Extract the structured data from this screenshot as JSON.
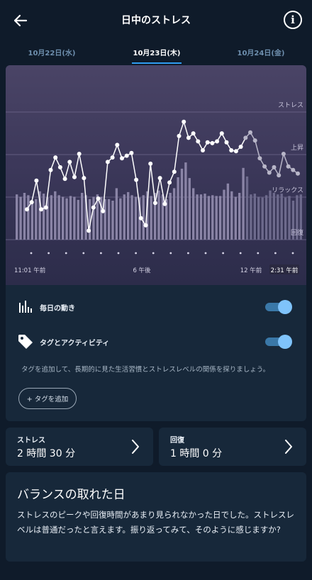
{
  "header": {
    "title": "日中のストレス",
    "back_icon": "arrow-left-icon",
    "info_icon": "info-circle-icon",
    "info_glyph": "i"
  },
  "date_tabs": [
    {
      "label": "10月22日(水)",
      "active": false
    },
    {
      "label": "10月23日(木)",
      "active": true
    },
    {
      "label": "10月24日(金)",
      "active": false
    }
  ],
  "chart": {
    "level_labels": [
      "ストレス",
      "上昇",
      "リラックス",
      "回復"
    ],
    "time_labels": {
      "start": "11:01 午前",
      "mid1": "6 午後",
      "mid2": "12 午前",
      "end": "2:31 午前"
    },
    "colors": {
      "line": "#ffffff",
      "bar": "#8a84a6",
      "bar_faded": "#6d6a8c",
      "line_faded": "#b8b6c8"
    }
  },
  "chart_data": {
    "type": "line",
    "x_range": [
      "11:01 午前",
      "2:31 午前"
    ],
    "y_levels": [
      "回復",
      "リラックス",
      "上昇",
      "ストレス"
    ],
    "stress_line": [
      0.34,
      0.42,
      0.66,
      0.34,
      0.36,
      0.78,
      0.92,
      0.81,
      0.68,
      0.87,
      0.7,
      0.96,
      0.69,
      0.1,
      0.36,
      0.46,
      0.32,
      0.87,
      0.92,
      1.06,
      0.91,
      0.94,
      0.97,
      0.67,
      0.24,
      0.16,
      0.85,
      0.41,
      0.69,
      0.4,
      0.64,
      0.76,
      1.16,
      1.32,
      1.14,
      1.19,
      1.1,
      1.0,
      1.09,
      1.08,
      1.1,
      1.19,
      1.09,
      1.0,
      0.99,
      1.04,
      1.14,
      1.2,
      1.11,
      0.91,
      0.82,
      0.75,
      0.81,
      0.72,
      0.96,
      0.82,
      0.78,
      0.74
    ],
    "body_battery_bars": [
      0.58,
      0.55,
      0.6,
      0.57,
      0.5,
      0.52,
      0.62,
      0.59,
      0.54,
      0.57,
      0.62,
      0.57,
      0.55,
      0.53,
      0.56,
      0.55,
      0.51,
      0.6,
      0.57,
      0.52,
      0.55,
      0.58,
      0.55,
      0.52,
      0.52,
      0.5,
      0.66,
      0.53,
      0.58,
      0.61,
      0.57,
      0.55,
      0.54,
      0.57,
      0.62,
      0.56,
      0.6,
      0.63,
      0.58,
      0.52,
      0.6,
      0.66,
      0.8,
      0.91,
      0.99,
      0.79,
      0.66,
      0.58,
      0.58,
      0.59,
      0.56,
      0.57,
      0.56,
      0.56,
      0.64,
      0.72,
      0.62,
      0.55,
      0.6,
      0.92,
      0.81,
      0.58,
      0.59,
      0.55,
      0.54,
      0.57,
      0.63,
      0.6,
      0.58,
      0.59,
      0.54,
      0.56,
      0.5,
      0.57,
      0.58
    ]
  },
  "toggles": [
    {
      "label": "毎日の動き",
      "icon": "activity-bars-icon",
      "on": true
    },
    {
      "label": "タグとアクティビティ",
      "icon": "tag-icon",
      "on": true
    }
  ],
  "tag_description": "タグを追加して、長期的に見た生活習慣とストレスレベルの関係を探りましょう。",
  "add_tag_label": "+ タグを追加",
  "stats": [
    {
      "caption": "ストレス",
      "value": "2 時間 30 分"
    },
    {
      "caption": "回復",
      "value": "1 時間 0 分"
    }
  ],
  "balance": {
    "title": "バランスの取れた日",
    "body": "ストレスのピークや回復時間があまり見られなかった日でした。ストレスレベルは普通だったと言えます。振り返ってみて、そのように感じますか?"
  }
}
